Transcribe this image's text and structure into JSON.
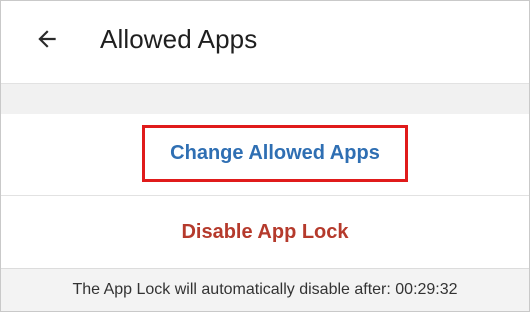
{
  "header": {
    "title": "Allowed Apps",
    "back_icon": "arrow-left-icon"
  },
  "actions": {
    "change_label": "Change Allowed Apps",
    "change_color": "#2f6fb3",
    "disable_label": "Disable App Lock",
    "disable_color": "#b53a2c",
    "highlight_color": "#e01b1b"
  },
  "footer": {
    "message": "The App Lock will automatically disable after: 00:29:32"
  }
}
